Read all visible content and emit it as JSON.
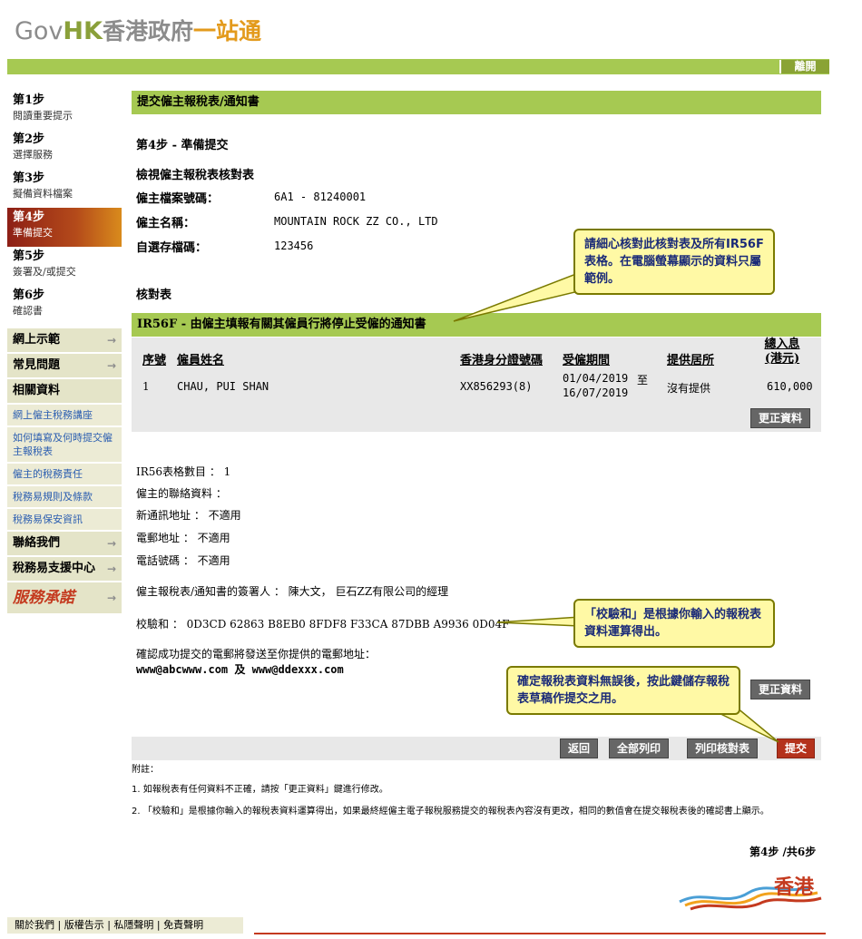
{
  "header": {
    "logo_gov": "Gov",
    "logo_hk": "HK",
    "logo_cn": "香港政府",
    "logo_one": "一站通",
    "logout": "離開"
  },
  "sidebar": {
    "steps": [
      {
        "title": "第1步",
        "sub": "閱讀重要提示"
      },
      {
        "title": "第2步",
        "sub": "選擇服務"
      },
      {
        "title": "第3步",
        "sub": "擬備資料檔案"
      },
      {
        "title": "第4步",
        "sub": "準備提交"
      },
      {
        "title": "第5步",
        "sub": "簽署及/或提交"
      },
      {
        "title": "第6步",
        "sub": "確認書"
      }
    ],
    "nav": {
      "demo": "網上示範",
      "faq": "常見問題",
      "related": "相關資料",
      "link1": "網上僱主稅務講座",
      "link2": "如何填寫及何時提交僱主報稅表",
      "link3": "僱主的稅務責任",
      "link4": "稅務易規則及條款",
      "link5": "稅務易保安資訊",
      "contact": "聯絡我們",
      "support": "稅務易支援中心",
      "brand": "服務承諾"
    },
    "arrow": "→"
  },
  "main": {
    "page_bar": "提交僱主報稅表/通知書",
    "step_heading": "第4步 - 準備提交",
    "review_heading": "檢視僱主報稅表核對表",
    "file_no_label": "僱主檔案號碼：",
    "file_no_value": "6A1 - 81240001",
    "employer_label": "僱主名稱：",
    "employer_value": "MOUNTAIN ROCK ZZ CO., LTD",
    "save_label": "自選存檔碼：",
    "save_value": "123456",
    "checklist_label": "核對表",
    "ir56f_bar": "IR56F - 由僱主填報有關其僱員行將停止受僱的通知書"
  },
  "table": {
    "headers": {
      "seq": "序號",
      "name": "僱員姓名",
      "hkid": "香港身分證號碼",
      "period": "受僱期間",
      "residence": "提供居所",
      "income": "總入息(港元)"
    },
    "rows": [
      {
        "seq": "1",
        "name": "CHAU, PUI SHAN",
        "hkid": "XX856293(8)",
        "period_from": "01/04/2019",
        "to": "至",
        "period_to": "16/07/2019",
        "residence": "沒有提供",
        "income": "610,000"
      }
    ]
  },
  "buttons": {
    "amend1": "更正資料",
    "amend2": "更正資料",
    "back": "返回",
    "print_all": "全部列印",
    "print_check": "列印核對表",
    "submit": "提交"
  },
  "info": {
    "ir56_count": "IR56表格數目 ： 1",
    "contact": "僱主的聯絡資料 ：",
    "address": "新通訊地址 ： 不適用",
    "email": "電郵地址 ： 不適用",
    "phone": "電話號碼 ： 不適用",
    "signatory": "僱主報稅表/通知書的簽署人 ： 陳大文， 巨石ZZ有限公司的經理",
    "checksum": "校驗和 ： 0D3CD 62863 B8EB0 8FDF8 F33CA 87DBB A9936 0D04F",
    "confirm_email_label": "確認成功提交的電郵將發送至你提供的電郵地址：",
    "confirm_email_value": "www@abcwww.com 及 www@ddexxx.com"
  },
  "callouts": {
    "c1": "請細心核對此核對表及所有IR56F表格。在電腦螢幕顯示的資料只屬範例。",
    "c2": "「校驗和」是根據你輸入的報稅表資料運算得出。",
    "c3": "確定報稅表資料無誤後，按此鍵儲存報稅表草稿作提交之用。"
  },
  "notes": {
    "title": "附註：",
    "n1": "1. 如報稅表有任何資料不正確，請按「更正資料」鍵進行修改。",
    "n2": "2. 「校驗和」是根據你輸入的報稅表資料運算得出，如果最終經僱主電子報稅服務提交的報稅表內容沒有更改，相同的數值會在提交報稅表後的確認書上顯示。"
  },
  "pager": "第4步 /共6步",
  "footer": {
    "links": "關於我們 | 版權告示 | 私隱聲明 | 免責聲明",
    "brand_hk": "香港"
  }
}
